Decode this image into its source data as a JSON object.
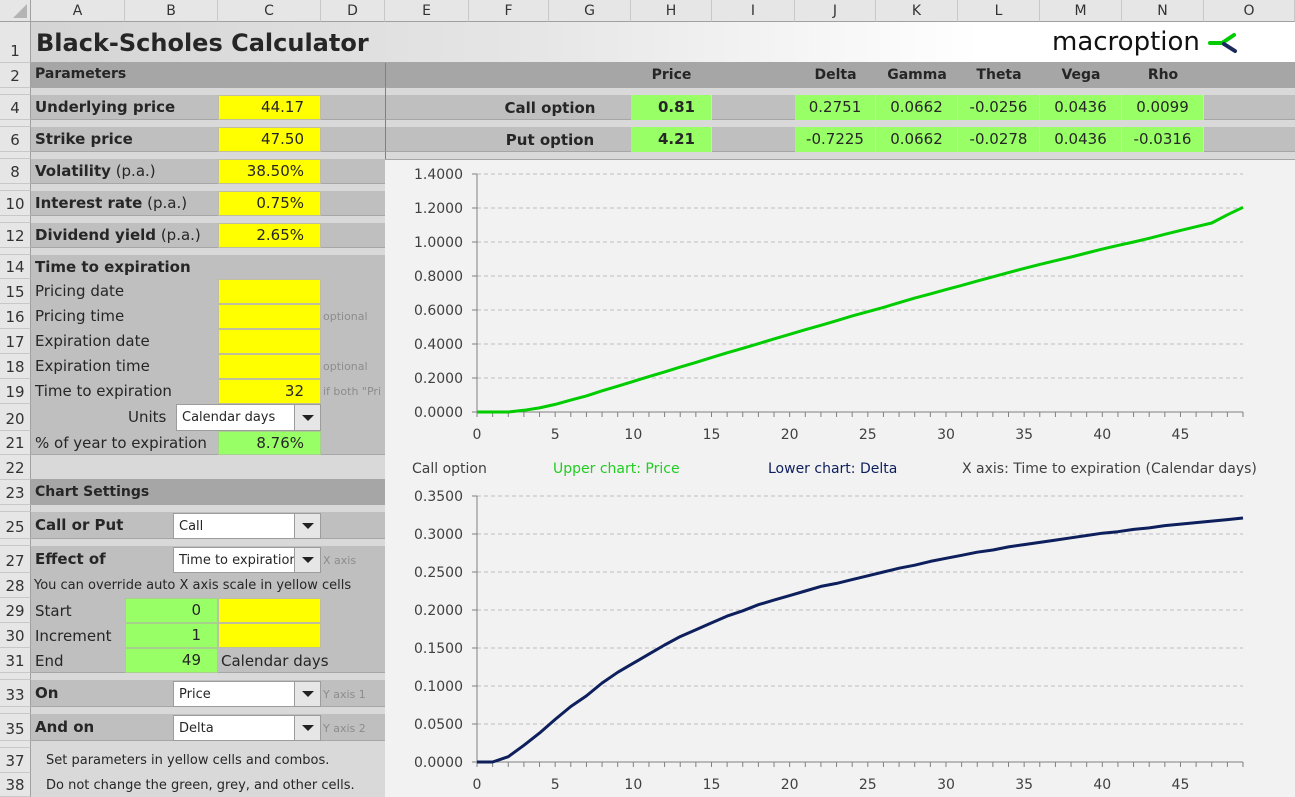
{
  "columns": [
    "A",
    "B",
    "C",
    "D",
    "E",
    "F",
    "G",
    "H",
    "I",
    "J",
    "K",
    "L",
    "M",
    "N",
    "O"
  ],
  "rows": [
    "1",
    "2",
    "4",
    "6",
    "8",
    "10",
    "12",
    "14",
    "15",
    "16",
    "17",
    "18",
    "19",
    "20",
    "21",
    "22",
    "23",
    "25",
    "27",
    "28",
    "29",
    "30",
    "31",
    "33",
    "35",
    "37",
    "38"
  ],
  "title": "Black-Scholes Calculator",
  "logo": {
    "text": "macroption",
    "icon": "macroption-arrow-icon",
    "colors": {
      "green": "#00cc00",
      "navy": "#1a2a5a"
    }
  },
  "parameters": {
    "header": "Parameters",
    "underlying_price": {
      "label": "Underlying price",
      "value": "44.17"
    },
    "strike_price": {
      "label": "Strike price",
      "value": "47.50"
    },
    "volatility": {
      "label": "Volatility",
      "suffix": "(p.a.)",
      "value": "38.50%"
    },
    "interest_rate": {
      "label": "Interest rate",
      "suffix": "(p.a.)",
      "value": "0.75%"
    },
    "dividend_yield": {
      "label": "Dividend yield",
      "suffix": "(p.a.)",
      "value": "2.65%"
    }
  },
  "time_to_expiration": {
    "header": "Time to expiration",
    "pricing_date": {
      "label": "Pricing date",
      "value": ""
    },
    "pricing_time": {
      "label": "Pricing time",
      "value": "",
      "hint": "optional"
    },
    "expiration_date": {
      "label": "Expiration date",
      "value": ""
    },
    "expiration_time": {
      "label": "Expiration time",
      "value": "",
      "hint": "optional"
    },
    "time_to_exp": {
      "label": "Time to expiration",
      "value": "32",
      "hint": "if both \"Pri"
    },
    "units": {
      "label": "Units",
      "value": "Calendar days"
    },
    "pct_year": {
      "label": "% of year to expiration",
      "value": "8.76%"
    }
  },
  "chart_settings": {
    "header": "Chart Settings",
    "call_or_put": {
      "label": "Call or Put",
      "value": "Call"
    },
    "effect_of": {
      "label": "Effect of",
      "value": "Time to expiration",
      "hint": "X axis"
    },
    "override_note": "You can override auto X axis scale in yellow cells",
    "start": {
      "label": "Start",
      "value": "0",
      "override": ""
    },
    "increment": {
      "label": "Increment",
      "value": "1",
      "override": ""
    },
    "end": {
      "label": "End",
      "value": "49",
      "unit": "Calendar days"
    },
    "on": {
      "label": "On",
      "value": "Price",
      "hint": "Y axis 1"
    },
    "and_on": {
      "label": "And on",
      "value": "Delta",
      "hint": "Y axis 2"
    },
    "note1": "Set parameters in yellow cells and combos.",
    "note2": "Do not change the green, grey, and other cells."
  },
  "results": {
    "headers": {
      "price": "Price",
      "delta": "Delta",
      "gamma": "Gamma",
      "theta": "Theta",
      "vega": "Vega",
      "rho": "Rho"
    },
    "call": {
      "label": "Call option",
      "price": "0.81",
      "delta": "0.2751",
      "gamma": "0.0662",
      "theta": "-0.0256",
      "vega": "0.0436",
      "rho": "0.0099"
    },
    "put": {
      "label": "Put option",
      "price": "4.21",
      "delta": "-0.7225",
      "gamma": "0.0662",
      "theta": "-0.0278",
      "vega": "0.0436",
      "rho": "-0.0316"
    }
  },
  "chart_caption": {
    "option": "Call option",
    "upper": "Upper chart: Price",
    "lower": "Lower chart: Delta",
    "xaxis": "X axis: Time to expiration (Calendar days)"
  },
  "colors": {
    "yellow": "#ffff00",
    "green": "#99ff66",
    "price_line": "#00cc00",
    "delta_line": "#0d1f5c"
  },
  "chart_data": [
    {
      "type": "line",
      "title": "Upper chart: Price",
      "xlabel": "Time to expiration (Calendar days)",
      "ylabel": "Price",
      "xlim": [
        0,
        49
      ],
      "ylim": [
        0,
        1.4
      ],
      "yticks": [
        "0.0000",
        "0.2000",
        "0.4000",
        "0.6000",
        "0.8000",
        "1.0000",
        "1.2000",
        "1.4000"
      ],
      "xticks": [
        "0",
        "5",
        "10",
        "15",
        "20",
        "25",
        "30",
        "35",
        "40",
        "45"
      ],
      "grid": true,
      "series": [
        {
          "name": "Price",
          "color": "#00cc00",
          "x": [
            0,
            1,
            2,
            3,
            4,
            5,
            6,
            7,
            8,
            9,
            10,
            11,
            12,
            13,
            14,
            15,
            16,
            17,
            18,
            19,
            20,
            21,
            22,
            23,
            24,
            25,
            26,
            27,
            28,
            29,
            30,
            31,
            32,
            33,
            34,
            35,
            36,
            37,
            38,
            39,
            40,
            41,
            42,
            43,
            44,
            45,
            46,
            47,
            48,
            49
          ],
          "y": [
            0,
            0,
            0,
            0.01,
            0.024,
            0.045,
            0.07,
            0.095,
            0.125,
            0.152,
            0.18,
            0.208,
            0.236,
            0.264,
            0.292,
            0.32,
            0.348,
            0.375,
            0.402,
            0.43,
            0.457,
            0.484,
            0.51,
            0.537,
            0.565,
            0.59,
            0.615,
            0.643,
            0.67,
            0.695,
            0.72,
            0.745,
            0.77,
            0.795,
            0.82,
            0.845,
            0.868,
            0.89,
            0.912,
            0.935,
            0.958,
            0.98,
            1.0,
            1.022,
            1.045,
            1.068,
            1.09,
            1.112,
            1.16,
            1.204
          ]
        }
      ]
    },
    {
      "type": "line",
      "title": "Lower chart: Delta",
      "xlabel": "Time to expiration (Calendar days)",
      "ylabel": "Delta",
      "xlim": [
        0,
        49
      ],
      "ylim": [
        0,
        0.35
      ],
      "yticks": [
        "0.0000",
        "0.0500",
        "0.1000",
        "0.1500",
        "0.2000",
        "0.2500",
        "0.3000",
        "0.3500"
      ],
      "xticks": [
        "0",
        "5",
        "10",
        "15",
        "20",
        "25",
        "30",
        "35",
        "40",
        "45"
      ],
      "grid": true,
      "series": [
        {
          "name": "Delta",
          "color": "#0d1f5c",
          "x": [
            0,
            1,
            2,
            3,
            4,
            5,
            6,
            7,
            8,
            9,
            10,
            11,
            12,
            13,
            14,
            15,
            16,
            17,
            18,
            19,
            20,
            21,
            22,
            23,
            24,
            25,
            26,
            27,
            28,
            29,
            30,
            31,
            32,
            33,
            34,
            35,
            36,
            37,
            38,
            39,
            40,
            41,
            42,
            43,
            44,
            45,
            46,
            47,
            48,
            49
          ],
          "y": [
            0,
            0,
            0.007,
            0.022,
            0.038,
            0.056,
            0.073,
            0.087,
            0.104,
            0.118,
            0.13,
            0.142,
            0.154,
            0.165,
            0.174,
            0.183,
            0.192,
            0.199,
            0.207,
            0.213,
            0.219,
            0.225,
            0.231,
            0.235,
            0.24,
            0.245,
            0.25,
            0.255,
            0.259,
            0.264,
            0.268,
            0.272,
            0.276,
            0.279,
            0.283,
            0.286,
            0.289,
            0.292,
            0.295,
            0.298,
            0.301,
            0.303,
            0.306,
            0.308,
            0.311,
            0.313,
            0.315,
            0.317,
            0.319,
            0.321
          ]
        }
      ]
    }
  ]
}
